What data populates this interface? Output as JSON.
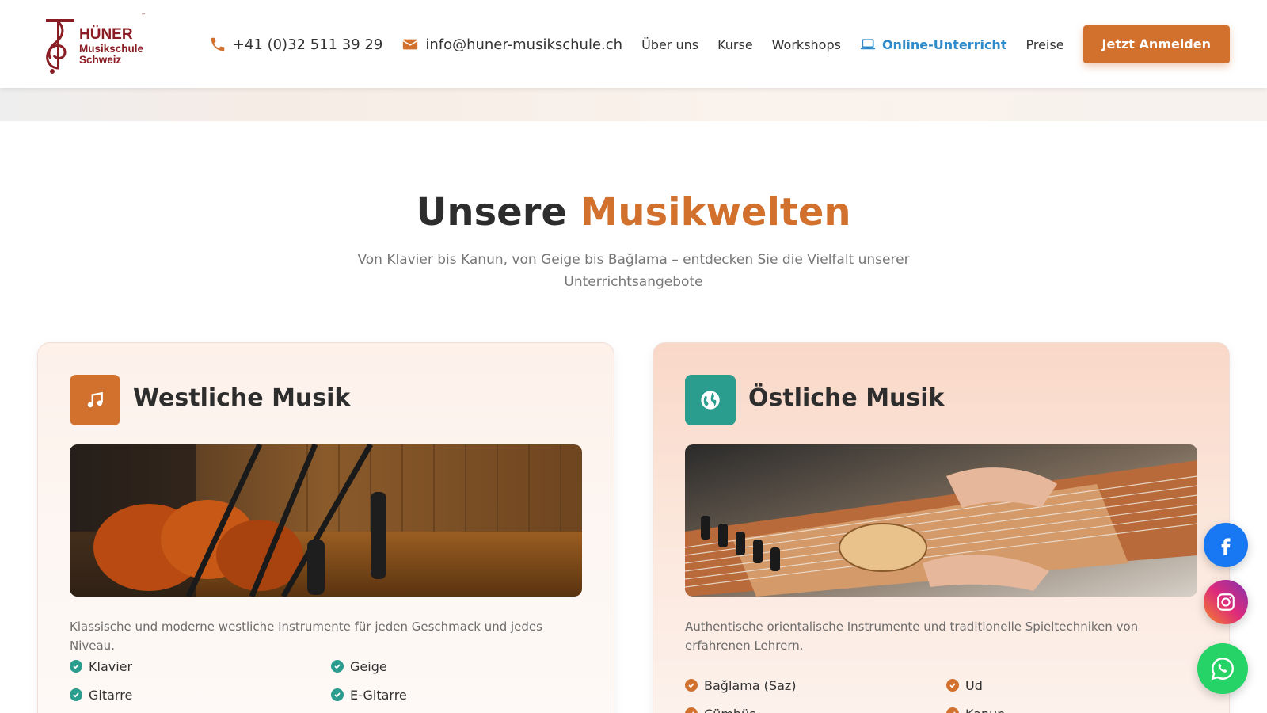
{
  "brand": {
    "name": "HÜNER",
    "line2": "Musikschule",
    "line3": "Schweiz",
    "tm": "™",
    "color": "#8a1d24"
  },
  "header": {
    "phone": "+41 (0)32 511 39 29",
    "email": "info@huner-musikschule.ch",
    "nav": [
      "Über uns",
      "Kurse",
      "Workshops",
      "Online-Unterricht",
      "Preise"
    ],
    "active_nav": "Online-Unterricht",
    "cta": "Jetzt Anmelden"
  },
  "section": {
    "title_part1": "Unsere",
    "title_part2": "Musikwelten",
    "subtitle_line1": "Von Klavier bis Kanun, von Geige bis Bağlama – entdecken Sie die Vielfalt unserer",
    "subtitle_line2": "Unterrichtsangebote"
  },
  "cards": {
    "west": {
      "icon": "music-note-icon",
      "title": "Westliche Musik",
      "image_alt": "violins-image",
      "description": "Klassische und moderne westliche Instrumente für jeden Geschmack und jedes Niveau.",
      "instruments": [
        "Klavier",
        "Geige",
        "Gitarre",
        "E-Gitarre"
      ]
    },
    "east": {
      "icon": "globe-icon",
      "title": "Östliche Musik",
      "image_alt": "kanun-image",
      "description": "Authentische orientalische Instrumente und traditionelle Spieltechniken von erfahrenen Lehrern.",
      "instruments": [
        "Bağlama (Saz)",
        "Ud",
        "Cümbüş",
        "Kanun"
      ]
    }
  },
  "social": [
    "facebook-icon",
    "instagram-icon",
    "whatsapp-icon"
  ],
  "colors": {
    "accent": "#d2702d",
    "teal": "#2a9d8f",
    "link_active": "#2f8bc9",
    "facebook": "#1877f2",
    "whatsapp": "#25d366"
  }
}
